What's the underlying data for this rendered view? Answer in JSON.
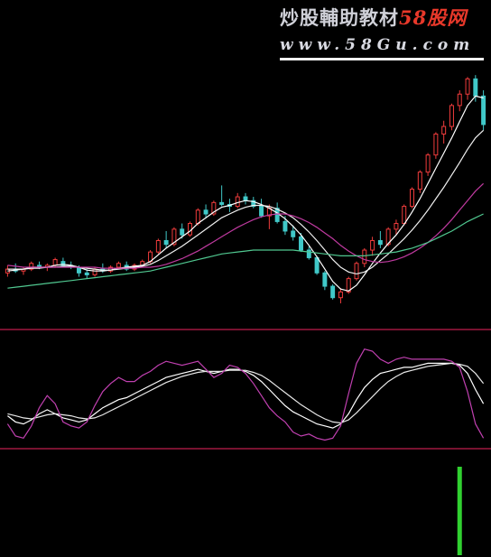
{
  "watermark": {
    "title_main": "炒股輔助教材",
    "title_brand": "58股网",
    "url": "www.58Gu.com"
  },
  "colors": {
    "background": "#000000",
    "candle_up": "#f03c3c",
    "candle_down": "#40c8c8",
    "ma_fast": "#ffffff",
    "ma_mid": "#f0f0f0",
    "ma_slow": "#c03aa0",
    "ma_long": "#50c890",
    "kdj_k": "#ffffff",
    "kdj_d": "#e8e8e8",
    "kdj_j": "#c040b0",
    "divider": "#a01840",
    "volume_bar": "#30d030"
  },
  "chart_data": [
    {
      "type": "candlestick",
      "panel": "price",
      "title": "",
      "candles": [
        [
          7.0,
          7.4,
          6.8,
          7.2
        ],
        [
          7.2,
          7.5,
          7.0,
          7.1
        ],
        [
          7.1,
          7.3,
          6.9,
          7.2
        ],
        [
          7.2,
          7.6,
          7.1,
          7.5
        ],
        [
          7.4,
          7.6,
          7.2,
          7.3
        ],
        [
          7.3,
          7.5,
          7.1,
          7.4
        ],
        [
          7.4,
          7.8,
          7.3,
          7.7
        ],
        [
          7.6,
          7.8,
          7.3,
          7.4
        ],
        [
          7.4,
          7.6,
          7.2,
          7.3
        ],
        [
          7.3,
          7.4,
          6.8,
          7.0
        ],
        [
          7.0,
          7.2,
          6.7,
          6.9
        ],
        [
          6.9,
          7.3,
          6.8,
          7.2
        ],
        [
          7.2,
          7.5,
          7.0,
          7.1
        ],
        [
          7.1,
          7.4,
          7.0,
          7.3
        ],
        [
          7.3,
          7.6,
          7.2,
          7.5
        ],
        [
          7.4,
          7.6,
          7.1,
          7.2
        ],
        [
          7.2,
          7.5,
          7.1,
          7.4
        ],
        [
          7.4,
          7.7,
          7.3,
          7.6
        ],
        [
          7.6,
          8.2,
          7.5,
          8.1
        ],
        [
          8.1,
          8.8,
          8.0,
          8.7
        ],
        [
          8.7,
          9.2,
          8.3,
          8.5
        ],
        [
          8.5,
          9.4,
          8.4,
          9.3
        ],
        [
          9.3,
          9.6,
          8.8,
          9.0
        ],
        [
          9.0,
          9.7,
          8.9,
          9.6
        ],
        [
          9.6,
          10.4,
          9.5,
          10.3
        ],
        [
          10.3,
          10.6,
          9.9,
          10.1
        ],
        [
          10.1,
          10.8,
          10.0,
          10.7
        ],
        [
          10.7,
          11.6,
          10.5,
          10.6
        ],
        [
          10.6,
          10.9,
          10.2,
          10.5
        ],
        [
          10.5,
          11.2,
          10.4,
          11.0
        ],
        [
          11.0,
          11.2,
          10.6,
          10.8
        ],
        [
          10.8,
          11.0,
          10.4,
          10.5
        ],
        [
          10.5,
          10.9,
          9.9,
          10.0
        ],
        [
          10.0,
          10.6,
          9.3,
          10.4
        ],
        [
          10.4,
          10.7,
          9.6,
          9.7
        ],
        [
          9.7,
          10.0,
          9.0,
          9.2
        ],
        [
          9.2,
          9.5,
          8.7,
          8.9
        ],
        [
          8.9,
          9.1,
          8.1,
          8.2
        ],
        [
          8.2,
          8.4,
          7.7,
          7.8
        ],
        [
          7.8,
          7.9,
          6.9,
          7.0
        ],
        [
          7.0,
          7.1,
          6.1,
          6.3
        ],
        [
          6.3,
          6.4,
          5.6,
          5.7
        ],
        [
          5.7,
          6.2,
          5.4,
          6.0
        ],
        [
          6.0,
          6.8,
          5.9,
          6.7
        ],
        [
          6.7,
          7.6,
          6.6,
          7.5
        ],
        [
          7.5,
          8.3,
          7.3,
          8.2
        ],
        [
          8.2,
          8.9,
          7.9,
          8.7
        ],
        [
          8.7,
          9.2,
          8.3,
          8.5
        ],
        [
          8.5,
          9.4,
          8.4,
          9.3
        ],
        [
          9.3,
          9.8,
          9.0,
          9.6
        ],
        [
          9.6,
          10.6,
          9.5,
          10.5
        ],
        [
          10.5,
          11.5,
          10.4,
          11.4
        ],
        [
          11.4,
          12.4,
          11.2,
          12.3
        ],
        [
          12.3,
          13.3,
          12.1,
          13.2
        ],
        [
          13.2,
          14.4,
          13.0,
          14.3
        ],
        [
          14.3,
          15.0,
          13.8,
          14.7
        ],
        [
          14.7,
          15.9,
          14.5,
          15.8
        ],
        [
          15.8,
          16.6,
          15.5,
          16.4
        ],
        [
          16.4,
          17.3,
          16.1,
          17.2
        ],
        [
          17.2,
          17.4,
          16.0,
          16.3
        ],
        [
          16.3,
          16.6,
          14.5,
          14.8
        ]
      ],
      "moving_averages": [
        {
          "label": "ma_fast",
          "values": [
            7.1,
            7.15,
            7.2,
            7.3,
            7.3,
            7.3,
            7.4,
            7.45,
            7.4,
            7.3,
            7.15,
            7.1,
            7.1,
            7.15,
            7.25,
            7.3,
            7.35,
            7.4,
            7.6,
            7.95,
            8.3,
            8.6,
            8.9,
            9.2,
            9.6,
            9.9,
            10.2,
            10.45,
            10.55,
            10.7,
            10.8,
            10.75,
            10.6,
            10.4,
            10.15,
            9.85,
            9.45,
            9.0,
            8.45,
            7.85,
            7.2,
            6.55,
            6.15,
            6.05,
            6.35,
            6.9,
            7.5,
            8.05,
            8.55,
            9.0,
            9.55,
            10.2,
            10.9,
            11.7,
            12.5,
            13.3,
            14.1,
            14.95,
            15.8,
            16.3,
            16.2
          ]
        },
        {
          "label": "ma_mid",
          "values": [
            7.2,
            7.2,
            7.2,
            7.25,
            7.25,
            7.3,
            7.3,
            7.35,
            7.35,
            7.3,
            7.25,
            7.2,
            7.15,
            7.15,
            7.2,
            7.25,
            7.3,
            7.35,
            7.45,
            7.65,
            7.9,
            8.15,
            8.4,
            8.7,
            9.0,
            9.3,
            9.6,
            9.9,
            10.1,
            10.3,
            10.45,
            10.55,
            10.55,
            10.5,
            10.35,
            10.15,
            9.9,
            9.55,
            9.15,
            8.7,
            8.2,
            7.7,
            7.3,
            7.05,
            6.95,
            7.05,
            7.3,
            7.65,
            8.0,
            8.4,
            8.8,
            9.25,
            9.75,
            10.3,
            10.9,
            11.5,
            12.15,
            12.8,
            13.5,
            14.1,
            14.5
          ]
        },
        {
          "label": "ma_slow",
          "values": [
            7.4,
            7.35,
            7.3,
            7.3,
            7.3,
            7.3,
            7.3,
            7.3,
            7.3,
            7.3,
            7.3,
            7.3,
            7.25,
            7.25,
            7.25,
            7.25,
            7.25,
            7.3,
            7.3,
            7.35,
            7.45,
            7.6,
            7.75,
            7.95,
            8.15,
            8.4,
            8.65,
            8.9,
            9.15,
            9.4,
            9.6,
            9.8,
            9.95,
            10.05,
            10.1,
            10.1,
            10.0,
            9.85,
            9.65,
            9.4,
            9.1,
            8.8,
            8.45,
            8.15,
            7.9,
            7.7,
            7.6,
            7.55,
            7.6,
            7.7,
            7.85,
            8.05,
            8.3,
            8.6,
            8.95,
            9.35,
            9.8,
            10.3,
            10.8,
            11.3,
            11.7
          ]
        },
        {
          "label": "ma_long",
          "values": [
            6.2,
            6.25,
            6.3,
            6.35,
            6.4,
            6.45,
            6.5,
            6.55,
            6.6,
            6.65,
            6.7,
            6.75,
            6.8,
            6.85,
            6.9,
            6.95,
            7.0,
            7.05,
            7.1,
            7.2,
            7.3,
            7.4,
            7.5,
            7.6,
            7.7,
            7.8,
            7.9,
            8.0,
            8.05,
            8.1,
            8.15,
            8.2,
            8.2,
            8.2,
            8.2,
            8.2,
            8.2,
            8.15,
            8.1,
            8.05,
            8.0,
            7.95,
            7.9,
            7.9,
            7.9,
            7.9,
            7.95,
            8.0,
            8.05,
            8.1,
            8.2,
            8.3,
            8.45,
            8.6,
            8.8,
            9.0,
            9.2,
            9.45,
            9.7,
            9.9,
            10.1
          ]
        }
      ],
      "ylim": [
        4.5,
        18.5
      ],
      "grid": false
    },
    {
      "type": "line",
      "panel": "oscillator",
      "title": "",
      "series": [
        {
          "label": "kdj_k",
          "values": [
            28,
            22,
            20,
            24,
            30,
            34,
            30,
            26,
            24,
            22,
            24,
            30,
            36,
            40,
            44,
            46,
            50,
            54,
            58,
            62,
            66,
            68,
            70,
            72,
            74,
            72,
            70,
            72,
            74,
            74,
            72,
            68,
            62,
            54,
            46,
            38,
            32,
            28,
            24,
            20,
            18,
            16,
            20,
            30,
            44,
            56,
            64,
            70,
            72,
            74,
            76,
            76,
            78,
            80,
            80,
            80,
            80,
            78,
            70,
            54,
            40
          ]
        },
        {
          "label": "kdj_d",
          "values": [
            30,
            28,
            26,
            25,
            27,
            29,
            30,
            29,
            28,
            26,
            25,
            26,
            29,
            33,
            37,
            41,
            45,
            49,
            53,
            57,
            61,
            64,
            67,
            69,
            71,
            72,
            72,
            72,
            73,
            73,
            73,
            71,
            68,
            63,
            57,
            51,
            45,
            39,
            34,
            29,
            25,
            22,
            21,
            24,
            31,
            39,
            47,
            55,
            62,
            67,
            71,
            73,
            75,
            77,
            78,
            79,
            80,
            79,
            77,
            70,
            60
          ]
        },
        {
          "label": "kdj_j",
          "values": [
            20,
            8,
            6,
            18,
            36,
            48,
            40,
            22,
            18,
            16,
            22,
            38,
            52,
            60,
            66,
            62,
            62,
            68,
            72,
            78,
            82,
            80,
            78,
            80,
            82,
            74,
            66,
            70,
            78,
            76,
            70,
            60,
            48,
            36,
            28,
            22,
            12,
            8,
            10,
            6,
            4,
            6,
            18,
            50,
            80,
            94,
            92,
            84,
            80,
            84,
            86,
            84,
            84,
            84,
            84,
            84,
            82,
            76,
            52,
            20,
            6
          ]
        }
      ],
      "ylim": [
        0,
        100
      ],
      "grid": false
    },
    {
      "type": "bar",
      "panel": "signal",
      "title": "",
      "values": [
        0,
        0,
        0,
        0,
        0,
        0,
        0,
        0,
        0,
        0,
        0,
        0,
        0,
        0,
        0,
        0,
        0,
        0,
        0,
        0,
        0,
        0,
        0,
        0,
        0,
        0,
        0,
        0,
        0,
        0,
        0,
        0,
        0,
        0,
        0,
        0,
        0,
        0,
        0,
        0,
        0,
        0,
        0,
        0,
        0,
        0,
        0,
        0,
        0,
        0,
        0,
        0,
        0,
        0,
        0,
        0,
        0,
        1,
        0,
        0,
        0
      ],
      "ylim": [
        0,
        1
      ],
      "grid": false
    }
  ]
}
